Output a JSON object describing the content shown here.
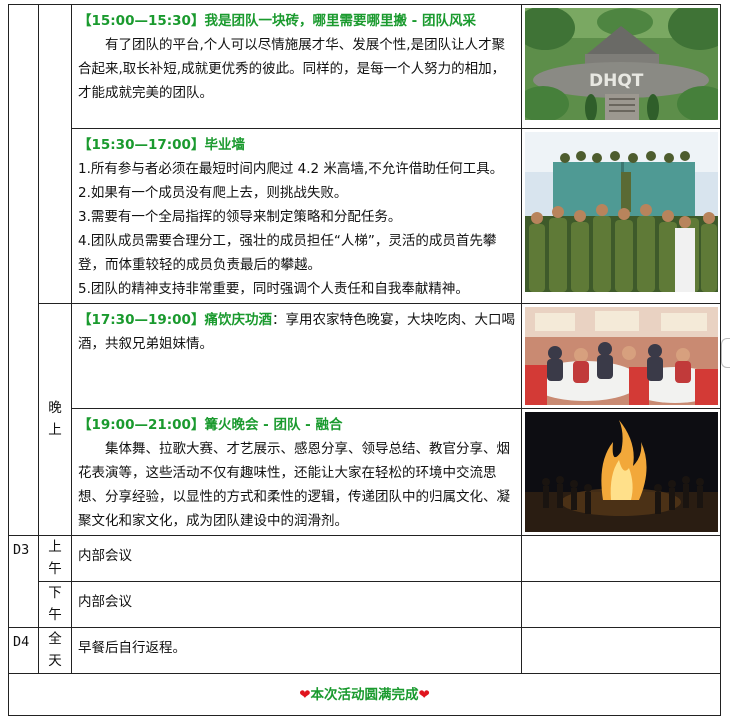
{
  "blocks": [
    {
      "heading": "【15:00—15:30】我是团队一块砖，哪里需要哪里搬 - 团队风采",
      "body": "有了团队的平台,个人可以尽情施展才华、发展个性,是团队让人才聚合起来,取长补短,成就更优秀的彼此。同样的，是每一个人努力的相加，才能成就完美的团队。",
      "image_label": "DHQT"
    },
    {
      "heading": "【15:30—17:00】毕业墙",
      "items": [
        "1.所有参与者必须在最短时间内爬过 4.2 米高墙,不允许借助任何工具。",
        "2.如果有一个成员没有爬上去，则挑战失败。",
        "3.需要有一个全局指挥的领导来制定策略和分配任务。",
        "4.团队成员需要合理分工，强壮的成员担任“人梯”，灵活的成员首先攀登，而体重较轻的成员负责最后的攀越。",
        "5.团队的精神支持非常重要，同时强调个人责任和自我奉献精神。"
      ]
    },
    {
      "period": "晚上",
      "heading": "【17:30—19:00】痛饮庆功酒",
      "body": "：享用农家特色晚宴，大块吃肉、大口喝酒，共叙兄弟姐妹情。"
    },
    {
      "heading": "【19:00—21:00】篝火晚会 - 团队 - 融合",
      "body": "集体舞、拉歌大赛、才艺展示、感恩分享、领导总结、教官分享、烟花表演等，这些活动不仅有趣味性，还能让大家在轻松的环境中交流思想、分享经验，以显性的方式和柔性的逻辑，传递团队中的归属文化、凝聚文化和家文化，成为团队建设中的润滑剂。"
    }
  ],
  "d3": {
    "day": "D3",
    "rows": [
      {
        "period": "上午",
        "text": "内部会议"
      },
      {
        "period": "下午",
        "text": "内部会议"
      }
    ]
  },
  "d4": {
    "day": "D4",
    "period": "全天",
    "text": "早餐后自行返程。"
  },
  "finale": {
    "heart": "❤",
    "text": "本次活动圆满完成"
  }
}
